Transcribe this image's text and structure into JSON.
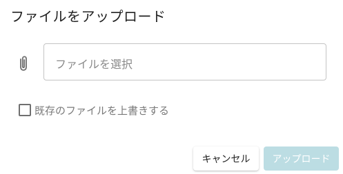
{
  "dialog": {
    "title": "ファイルをアップロード",
    "file_input": {
      "placeholder": "ファイルを選択",
      "value": "",
      "icon": "paperclip-icon"
    },
    "overwrite": {
      "label": "既存のファイルを上書きする",
      "checked": false
    },
    "actions": {
      "cancel_label": "キャンセル",
      "upload_label": "アップロード",
      "upload_enabled": false
    }
  },
  "colors": {
    "upload_disabled_bg": "#bcdde3",
    "text_primary": "#222222",
    "text_secondary": "#7a7a7a",
    "border": "#c4c4c4"
  }
}
